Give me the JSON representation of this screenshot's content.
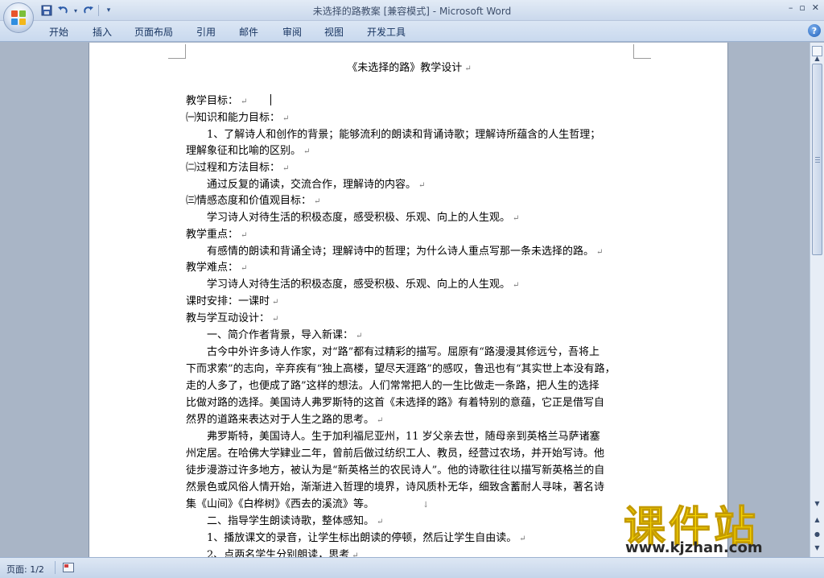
{
  "window": {
    "title_doc": "未选择的路教案 [兼容模式]",
    "title_sep": " - ",
    "title_app": "Microsoft Word",
    "min_glyph": "–",
    "max_glyph": "▫",
    "close_glyph": "✕"
  },
  "quick_access": {
    "save_icon": "save-icon",
    "undo_icon": "undo-icon",
    "redo_icon": "repeat-icon",
    "customize_glyph": "▾"
  },
  "ribbon": {
    "tabs": [
      "开始",
      "插入",
      "页面布局",
      "引用",
      "邮件",
      "审阅",
      "视图",
      "开发工具"
    ],
    "help": "?"
  },
  "document": {
    "title": "《未选择的路》教学设计",
    "lines": [
      "教学目标：",
      "㈠知识和能力目标：",
      "　　1、了解诗人和创作的背景；能够流利的朗读和背诵诗歌；理解诗所蕴含的人生哲理；",
      "理解象征和比喻的区别。",
      "㈡过程和方法目标：",
      "　　通过反复的诵读，交流合作，理解诗的内容。",
      "㈢情感态度和价值观目标：",
      "　　学习诗人对待生活的积极态度，感受积极、乐观、向上的人生观。",
      "教学重点：",
      "　　有感情的朗读和背诵全诗；理解诗中的哲理；为什么诗人重点写那一条未选择的路。",
      "教学难点：",
      "　　学习诗人对待生活的积极态度，感受积极、乐观、向上的人生观。",
      "课时安排：一课时",
      "教与学互动设计：",
      "　　一、简介作者背景，导入新课：",
      "　　古今中外许多诗人作家，对“路”都有过精彩的描写。屈原有“路漫漫其修远兮，吾将上",
      "下而求索”的志向，辛弃疾有“独上高楼，望尽天涯路”的感叹，鲁迅也有“其实世上本没有路，",
      "走的人多了，也便成了路”这样的想法。人们常常把人的一生比做走一条路，把人生的选择",
      "比做对路的选择。美国诗人弗罗斯特的这首《未选择的路》有着特别的意蕴，它正是借写自",
      "然界的道路来表达对于人生之路的思考。",
      "　　弗罗斯特，美国诗人。生于加利福尼亚州，11 岁父亲去世，随母亲到英格兰马萨诸塞",
      "州定居。在哈佛大学肄业二年，曾前后做过纺织工人、教员，经营过农场，并开始写诗。他",
      "徒步漫游过许多地方，被认为是“新英格兰的农民诗人”。他的诗歌往往以描写新英格兰的自",
      "然景色或风俗人情开始，渐渐进入哲理的境界，诗风质朴无华，细致含蓄耐人寻味，著名诗",
      "集《山间》《白桦树》《西去的溪流》等。",
      "　　二、指导学生朗读诗歌，整体感知。",
      "　　1、播放课文的录音，让学生标出朗读的停顿，然后让学生自由读。",
      "　　2、点两名学生分别朗读，思考"
    ],
    "paragraph_mark": "↵",
    "down_arrow": "↓"
  },
  "statusbar": {
    "page": "页面: 1/2"
  },
  "watermark": {
    "brand": "课件站",
    "url": "www.kjzhan.com"
  },
  "colors": {
    "title_bar": "#dbe6f4",
    "workspace": "#a9b5c6",
    "watermark_yellow": "#f6d400"
  }
}
